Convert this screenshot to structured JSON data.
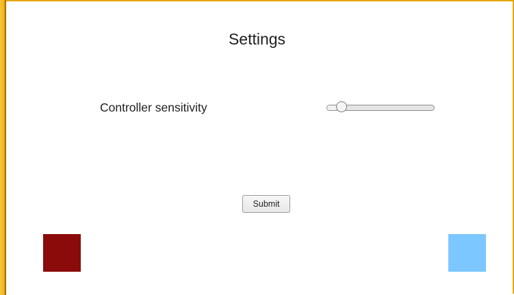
{
  "page": {
    "title": "Settings"
  },
  "settings": {
    "sensitivity": {
      "label": "Controller sensitivity",
      "value_fraction": 0.14
    }
  },
  "actions": {
    "submit_label": "Submit"
  },
  "decor": {
    "left_square_color": "#8b0a0a",
    "right_square_color": "#7cc7ff",
    "frame_color": "#f3b516"
  }
}
